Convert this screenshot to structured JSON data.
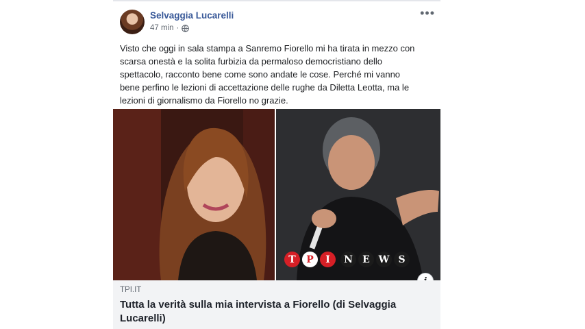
{
  "post": {
    "author": "Selvaggia Lucarelli",
    "time": "47 min",
    "separator": "·",
    "more": "•••",
    "body_lines": [
      "Visto che oggi in sala stampa a Sanremo Fiorello mi ha tirata in mezzo con",
      "scarsa onestà e la solita furbizia da permaloso democristiano dello",
      "spettacolo, racconto bene come sono andate le cose. Perché mi vanno",
      "bene perfino le lezioni di accettazione delle rughe da Diletta Leotta, ma le",
      "lezioni di giornalismo da Fiorello no grazie."
    ]
  },
  "image": {
    "badge_letters": [
      "T",
      "P",
      "I"
    ],
    "news_letters": [
      "N",
      "E",
      "W",
      "S"
    ],
    "info_label": "i"
  },
  "link": {
    "domain": "TPI.IT",
    "title_line1": "Tutta la verità sulla mia intervista a Fiorello (di Selvaggia",
    "title_line2": "Lucarelli)"
  },
  "colors": {
    "author": "#385898",
    "brand_red": "#d61f26"
  },
  "icons": {
    "privacy": "globe-icon",
    "menu": "more-options-icon",
    "info": "info-icon"
  }
}
